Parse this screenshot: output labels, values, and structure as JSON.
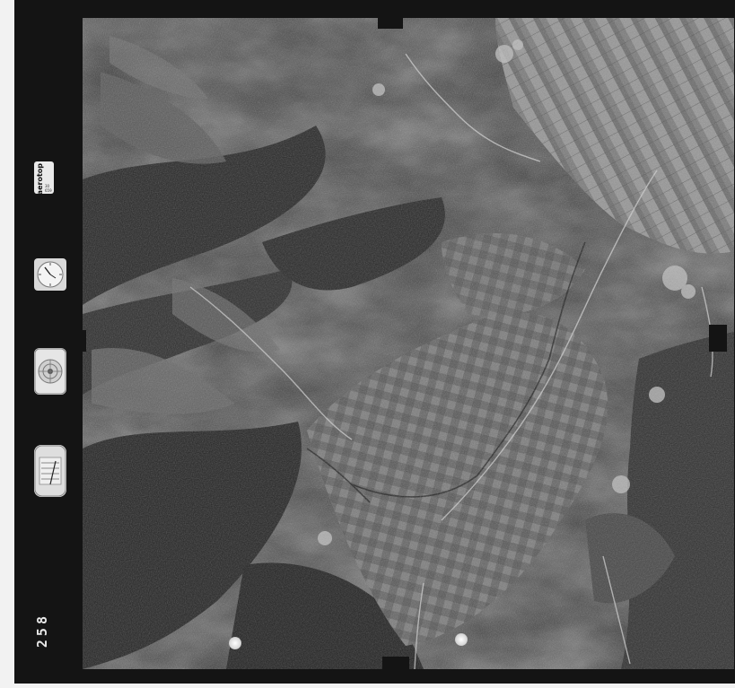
{
  "logo": {
    "text": "aerotop",
    "sub": "30 659"
  },
  "frame_number": "258",
  "instruments": {
    "clock": "clock-icon",
    "level": "bubble-level-icon",
    "altimeter": "altimeter-icon"
  },
  "colors": {
    "border": "#141414",
    "paper": "#f2f2f2"
  }
}
